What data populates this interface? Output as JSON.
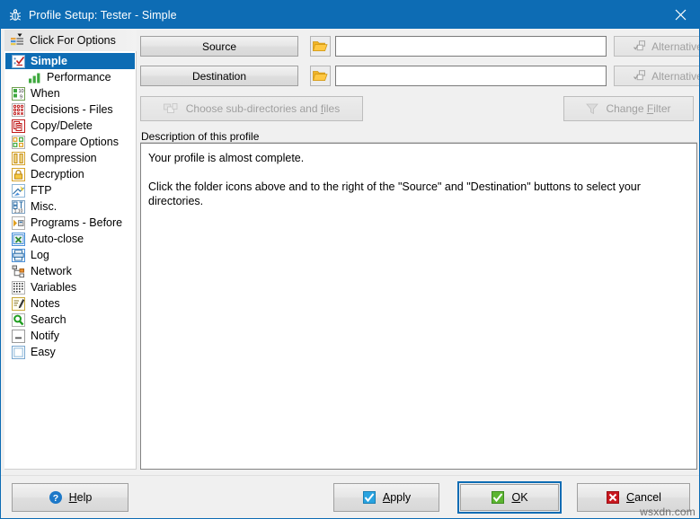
{
  "window": {
    "title": "Profile Setup: Tester - Simple",
    "title_icon": "beetle-icon",
    "close_icon": "close-icon",
    "accent_color": "#0d6cb4",
    "titlebar_bg": "#0d6cb4",
    "face_color": "#f0f0f0"
  },
  "sidebar": {
    "header": {
      "label": "Click For Options",
      "icon": "options-list-icon"
    },
    "items": [
      {
        "label": "Simple",
        "icon": "checklist-icon",
        "selected": true,
        "indent": false
      },
      {
        "label": "Performance",
        "icon": "bar-chart-icon",
        "selected": false,
        "indent": true
      },
      {
        "label": "When",
        "icon": "calendar-clock-icon",
        "selected": false,
        "indent": false
      },
      {
        "label": "Decisions - Files",
        "icon": "decisions-grid-icon",
        "selected": false,
        "indent": false
      },
      {
        "label": "Copy/Delete",
        "icon": "copy-delete-icon",
        "selected": false,
        "indent": false
      },
      {
        "label": "Compare Options",
        "icon": "compare-icon",
        "selected": false,
        "indent": false
      },
      {
        "label": "Compression",
        "icon": "compression-icon",
        "selected": false,
        "indent": false
      },
      {
        "label": "Decryption",
        "icon": "lock-icon",
        "selected": false,
        "indent": false
      },
      {
        "label": "FTP",
        "icon": "ftp-icon",
        "selected": false,
        "indent": false
      },
      {
        "label": "Misc.",
        "icon": "misc-icon",
        "selected": false,
        "indent": false
      },
      {
        "label": "Programs - Before",
        "icon": "programs-icon",
        "selected": false,
        "indent": false
      },
      {
        "label": "Auto-close",
        "icon": "auto-close-icon",
        "selected": false,
        "indent": false
      },
      {
        "label": "Log",
        "icon": "log-icon",
        "selected": false,
        "indent": false
      },
      {
        "label": "Network",
        "icon": "network-icon",
        "selected": false,
        "indent": false
      },
      {
        "label": "Variables",
        "icon": "variables-icon",
        "selected": false,
        "indent": false
      },
      {
        "label": "Notes",
        "icon": "notes-icon",
        "selected": false,
        "indent": false
      },
      {
        "label": "Search",
        "icon": "magnifier-icon",
        "selected": false,
        "indent": false
      },
      {
        "label": "Notify",
        "icon": "notify-icon",
        "selected": false,
        "indent": false
      },
      {
        "label": "Easy",
        "icon": "easy-square-icon",
        "selected": false,
        "indent": false
      }
    ]
  },
  "main": {
    "source_row": {
      "button_label": "Source",
      "folder_icon": "folder-icon",
      "input_value": "",
      "input_placeholder": "",
      "alternatives_label": "Alternatives",
      "alternatives_icon": "alternatives-icon",
      "alternatives_disabled": true
    },
    "destination_row": {
      "button_label": "Destination",
      "folder_icon": "folder-icon",
      "input_value": "",
      "input_placeholder": "",
      "alternatives_label": "Alternatives",
      "alternatives_icon": "alternatives-icon",
      "alternatives_disabled": true
    },
    "subdirectories_button": {
      "label_before": "Choose sub-directories and ",
      "accel": "f",
      "label_after": "iles",
      "icon": "folders-files-icon",
      "disabled": true
    },
    "filter_button": {
      "label_before": "Change ",
      "accel": "F",
      "label_after": "ilter",
      "icon": "funnel-icon",
      "disabled": true
    },
    "description_group_label": "Description of this profile",
    "description_lines": [
      "Your profile is almost complete.",
      "Click the folder icons above and to the right of the \"Source\" and \"Destination\" buttons to select your directories."
    ]
  },
  "footer": {
    "help": {
      "label_before": "",
      "accel": "H",
      "label_after": "elp",
      "icon": "help-circle-icon"
    },
    "apply": {
      "label_before": "",
      "accel": "A",
      "label_after": "pply",
      "icon": "apply-check-icon"
    },
    "ok": {
      "label_before": "",
      "accel": "O",
      "label_after": "K",
      "icon": "ok-check-icon",
      "focused": true
    },
    "cancel": {
      "label_before": "",
      "accel": "C",
      "label_after": "ancel",
      "icon": "cancel-x-icon"
    }
  },
  "watermark": "wsxdn.com"
}
